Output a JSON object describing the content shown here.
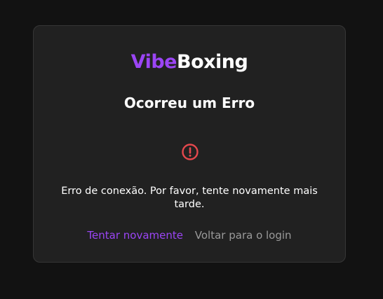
{
  "brand": {
    "part1": "Vibe",
    "part2": "Boxing",
    "accent_color": "#9b45f5"
  },
  "error": {
    "title": "Ocorreu um Erro",
    "icon": "error-circle-icon",
    "icon_color": "#e5484d",
    "message": "Erro de conexão. Por favor, tente novamente mais tarde."
  },
  "actions": {
    "retry_label": "Tentar novamente",
    "back_label": "Voltar para o login"
  }
}
